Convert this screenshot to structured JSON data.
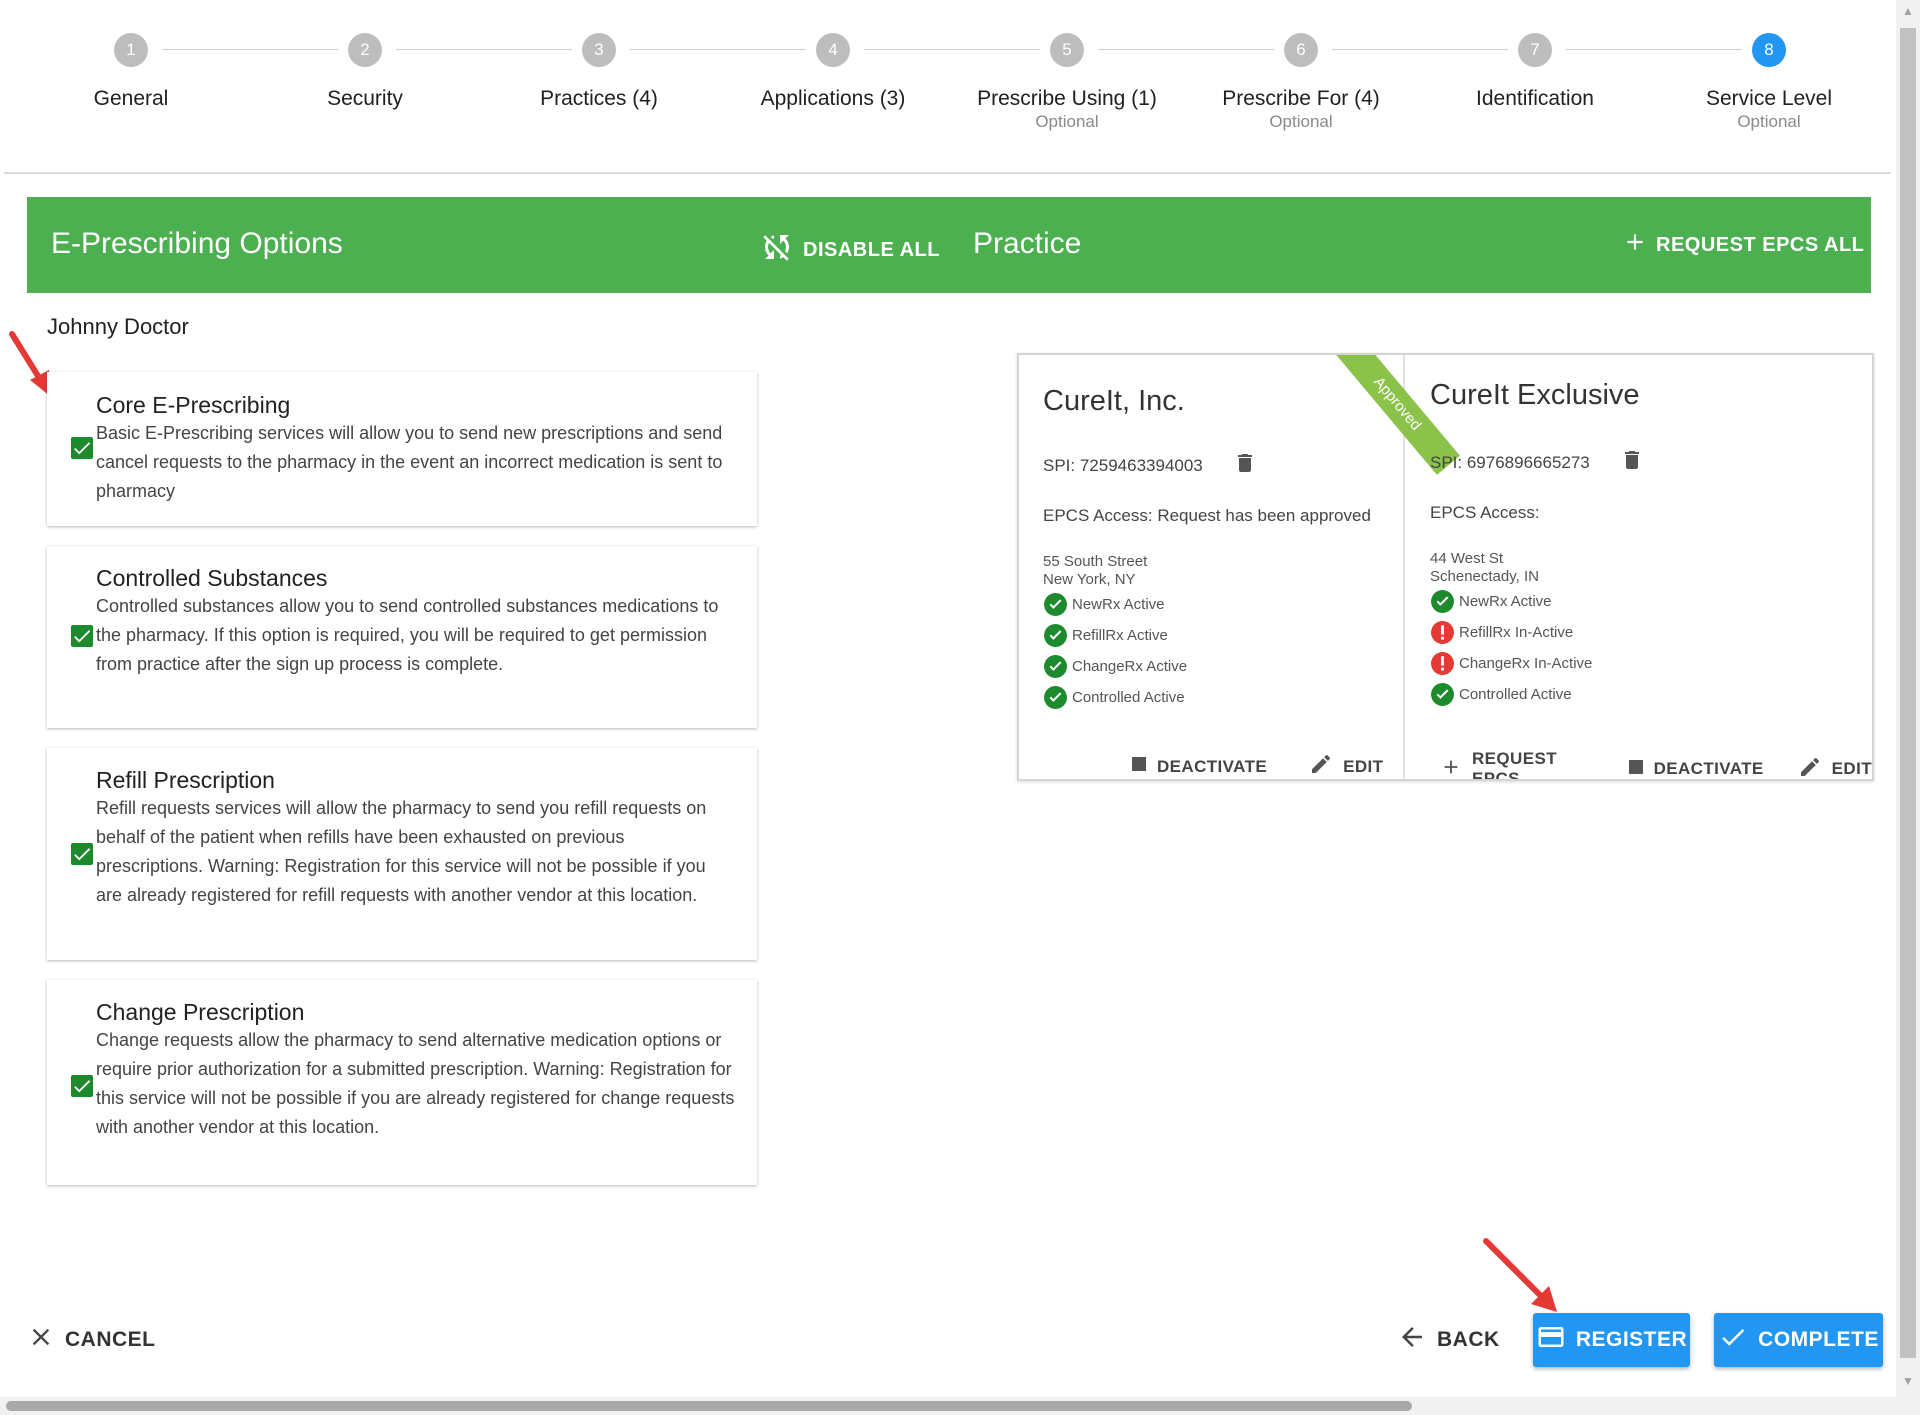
{
  "stepper": {
    "steps": [
      {
        "number": "1",
        "label": "General",
        "sub": "",
        "active": false
      },
      {
        "number": "2",
        "label": "Security",
        "sub": "",
        "active": false
      },
      {
        "number": "3",
        "label": "Practices (4)",
        "sub": "",
        "active": false
      },
      {
        "number": "4",
        "label": "Applications (3)",
        "sub": "",
        "active": false
      },
      {
        "number": "5",
        "label": "Prescribe Using (1)",
        "sub": "Optional",
        "active": false
      },
      {
        "number": "6",
        "label": "Prescribe For (4)",
        "sub": "Optional",
        "active": false
      },
      {
        "number": "7",
        "label": "Identification",
        "sub": "",
        "active": false
      },
      {
        "number": "8",
        "label": "Service Level",
        "sub": "Optional",
        "active": true
      }
    ]
  },
  "toolbar": {
    "title": "E-Prescribing Options",
    "disable_all": "DISABLE ALL",
    "practice_label": "Practice",
    "request_epcs_all": "REQUEST EPCS ALL"
  },
  "user": {
    "name": "Johnny Doctor"
  },
  "options": [
    {
      "title": "Core E-Prescribing",
      "description": "Basic E-Prescribing services will allow you to send new prescriptions and send cancel requests to the pharmacy in the event an incorrect medication is sent to pharmacy",
      "checked": true
    },
    {
      "title": "Controlled Substances",
      "description": "Controlled substances allow you to send controlled substances medications to the pharmacy. If this option is required, you will be required to get permission from practice after the sign up process is complete.",
      "checked": true
    },
    {
      "title": "Refill Prescription",
      "description": "Refill requests services will allow the pharmacy to send you refill requests on behalf of the patient when refills have been exhausted on previous prescriptions. Warning: Registration for this service will not be possible if you are already registered for refill requests with another vendor at this location.",
      "checked": true
    },
    {
      "title": "Change Prescription",
      "description": "Change requests allow the pharmacy to send alternative medication options or require prior authorization for a submitted prescription. Warning: Registration for this service will not be possible if you are already registered for change requests with another vendor at this location.",
      "checked": true
    }
  ],
  "practices": [
    {
      "name": "CureIt, Inc.",
      "ribbon": "Approved",
      "spi": "SPI: 7259463394003",
      "epcs": "EPCS Access: Request has been approved",
      "address_line1": "55 South Street",
      "address_line2": "New York, NY",
      "statuses": [
        {
          "text": "NewRx Active",
          "state": "ok"
        },
        {
          "text": "RefillRx Active",
          "state": "ok"
        },
        {
          "text": "ChangeRx Active",
          "state": "ok"
        },
        {
          "text": "Controlled Active",
          "state": "ok"
        }
      ],
      "actions": {
        "deactivate": "DEACTIVATE",
        "edit": "EDIT"
      }
    },
    {
      "name": "CureIt Exclusive",
      "spi": "SPI: 6976896665273",
      "epcs": "EPCS Access:",
      "address_line1": "44 West St",
      "address_line2": "Schenectady, IN",
      "statuses": [
        {
          "text": "NewRx Active",
          "state": "ok"
        },
        {
          "text": "RefillRx In-Active",
          "state": "error"
        },
        {
          "text": "ChangeRx In-Active",
          "state": "error"
        },
        {
          "text": "Controlled Active",
          "state": "ok"
        }
      ],
      "actions": {
        "request_epcs": "REQUEST EPCS",
        "deactivate": "DEACTIVATE",
        "edit": "EDIT"
      }
    }
  ],
  "footer": {
    "cancel": "CANCEL",
    "back": "BACK",
    "register": "REGISTER",
    "complete": "COMPLETE"
  },
  "colors": {
    "toolbar_green": "#4caf50",
    "primary_blue": "#2196f3",
    "check_green": "#1e8a2e",
    "status_ok": "#1e8a2e",
    "status_error": "#e53935",
    "annotation_arrow": "#e53935"
  },
  "icons": {
    "disable_all": "sync-disabled-icon",
    "request_epcs_all": "plus-icon",
    "delete": "trash-icon",
    "deactivate": "stop-square-icon",
    "edit": "pencil-icon",
    "cancel": "close-icon",
    "back": "arrow-left-icon",
    "register": "credit-card-icon",
    "complete": "check-icon"
  }
}
